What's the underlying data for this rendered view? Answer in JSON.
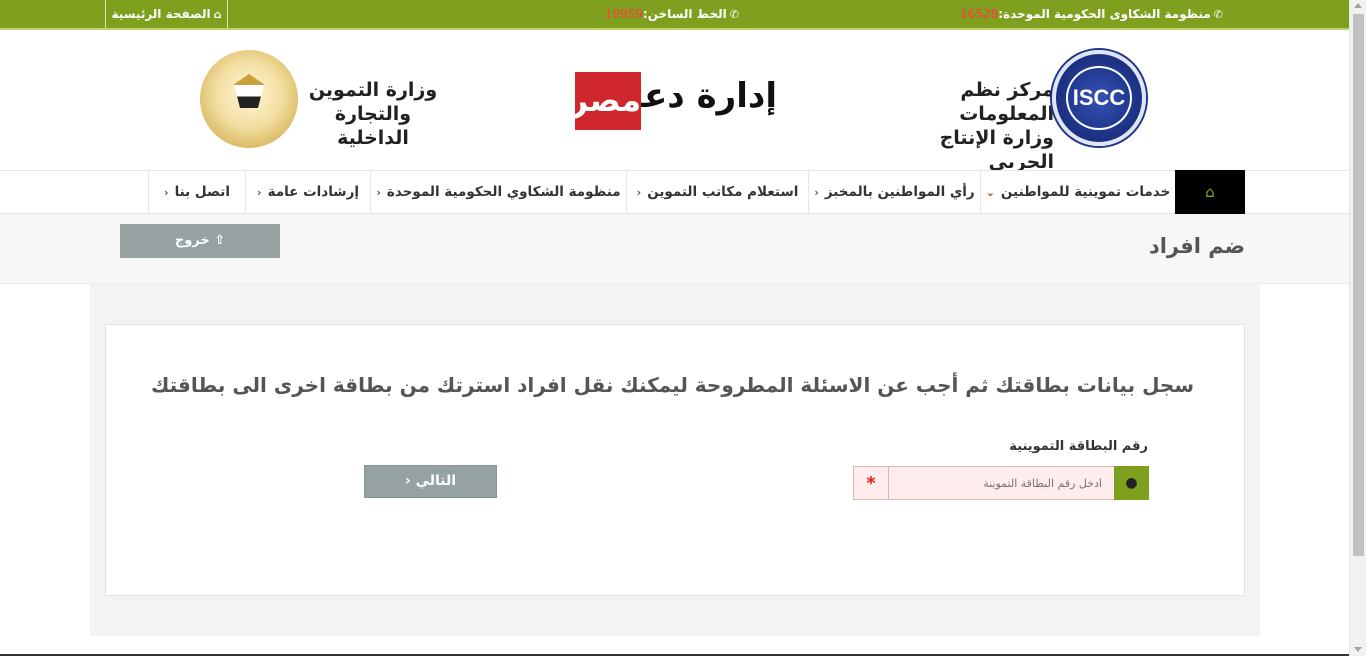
{
  "topbar": {
    "complaints_label": "منظومة الشكاوى الحكومية الموحدة:",
    "complaints_number": "16528",
    "hotline_label": "الخط الساخن:",
    "hotline_number": "19959",
    "home_link": "الصفحة الرئيسية",
    "bg_color": "#7f9f1f"
  },
  "header": {
    "left_logo_icon": "egypt-eagle-emblem",
    "ministry_line1": "وزارة التموين",
    "ministry_line2": "والتجارة الداخلية",
    "dam_part1": "إدارة دعم",
    "dam_part2": "مصر",
    "iscc_line1": "مركز نظم المعلومات",
    "iscc_line2": "وزارة الإنتاج الحربي",
    "iscc_logo_text": "ISCC"
  },
  "nav": {
    "home_icon": "home-icon",
    "items": [
      "خدمات تموينية للمواطنين",
      "رأي المواطنين بالمخبز",
      "استعلام مكاتب التموين",
      "منظومة الشكاوي الحكومية الموحدة",
      "إرشادات عامة",
      "اتصل بنا"
    ]
  },
  "page": {
    "title": "ضم افراد",
    "logout_label": "خروج"
  },
  "form": {
    "intro": "سجل بيانات بطاقتك ثم أجب عن الاسئلة المطروحة ليمكنك نقل افراد استرتك من بطاقة اخرى الى بطاقتك",
    "card_label": "رقم البطاقة التموينية",
    "card_placeholder": "ادخل رقم البطاقة التموينة",
    "card_value": "",
    "required_mark": "*",
    "next_label": "التالي"
  }
}
